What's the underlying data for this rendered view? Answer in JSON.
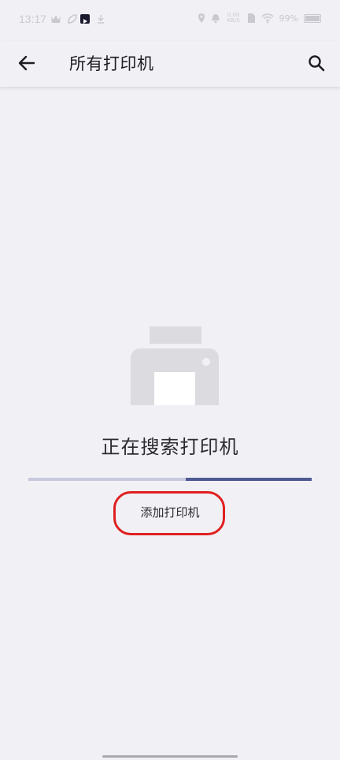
{
  "status_bar": {
    "time": "13:17",
    "network_speed": "0.00\nKB/S",
    "battery": "99%",
    "icons": [
      "crown-icon",
      "leaf-icon",
      "play-app-icon",
      "download-icon",
      "location-icon",
      "alarm-icon",
      "sim-icon",
      "wifi-icon",
      "battery-icon"
    ]
  },
  "app_bar": {
    "title": "所有打印机",
    "back_icon": "arrow-left-icon",
    "search_icon": "search-icon"
  },
  "main": {
    "illustration": "printer-icon",
    "status_text": "正在搜索打印机",
    "progress": 0.44,
    "add_printer_label": "添加打印机"
  },
  "colors": {
    "background": "#f1f0f5",
    "progress_track": "#c8c9dd",
    "progress_fill": "#4f5a92",
    "highlight": "#e02020",
    "illustration": "#dcdbe0"
  }
}
